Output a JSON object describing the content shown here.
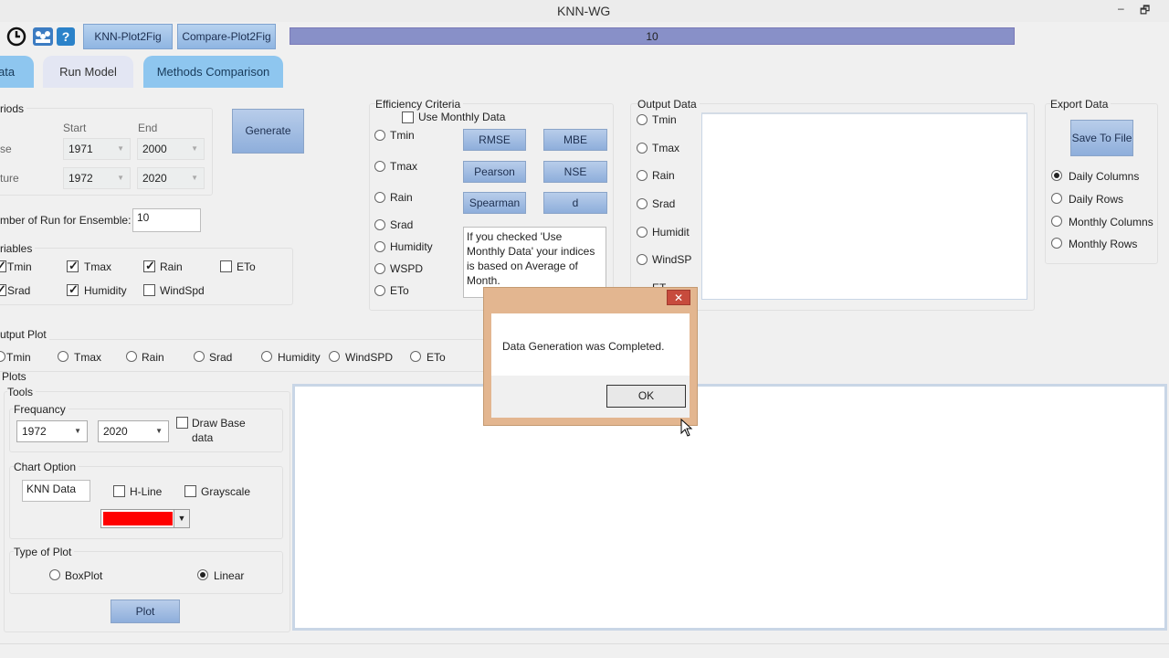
{
  "window": {
    "title": "KNN-WG"
  },
  "toolbar": {
    "icons": [
      "refresh-icon",
      "team-icon",
      "help-icon"
    ],
    "btn_plot2fig": "KNN-Plot2Fig",
    "btn_compare": "Compare-Plot2Fig",
    "progress_value": 10,
    "progress_fraction": 1.0
  },
  "tabs": {
    "data": "ata",
    "run": "Run Model",
    "methods": "Methods Comparison"
  },
  "periods": {
    "title": "riods",
    "start_label": "Start",
    "end_label": "End",
    "base_label": "se",
    "future_label": "ture",
    "base_start": "1971",
    "base_end": "2000",
    "future_start": "1972",
    "future_end": "2020"
  },
  "generate_label": "Generate",
  "ensemble": {
    "label": "mber of Run for Ensemble:",
    "value": "10"
  },
  "variables": {
    "title": "riables",
    "items": [
      {
        "label": "Tmin",
        "checked": true
      },
      {
        "label": "Tmax",
        "checked": true
      },
      {
        "label": "Rain",
        "checked": true
      },
      {
        "label": "ETo",
        "checked": false
      },
      {
        "label": "Srad",
        "checked": true
      },
      {
        "label": "Humidity",
        "checked": true
      },
      {
        "label": "WindSpd",
        "checked": false
      }
    ]
  },
  "efficiency": {
    "title": "Efficiency Criteria",
    "monthly_label": "Use Monthly Data",
    "radios": [
      "Tmin",
      "Tmax",
      "Rain",
      "Srad",
      "Humidity",
      "WSPD",
      "ETo"
    ],
    "buttons": {
      "rmse": "RMSE",
      "mbe": "MBE",
      "pearson": "Pearson",
      "nse": "NSE",
      "spearman": "Spearman",
      "d": "d"
    },
    "note": "If you checked 'Use Monthly Data' your indices is based on Average of Month."
  },
  "output_data": {
    "title": "Output Data",
    "radios": [
      "Tmin",
      "Tmax",
      "Rain",
      "Srad",
      "Humidit",
      "WindSPI",
      "ET"
    ]
  },
  "export": {
    "title": "Export  Data",
    "save_label": "Save To File",
    "options": [
      "Daily Columns",
      "Daily Rows",
      "Monthly Columns",
      "Monthly Rows"
    ],
    "selected": "Daily Columns"
  },
  "output_plot": {
    "title": "utput Plot",
    "options": [
      "Tmin",
      "Tmax",
      "Rain",
      "Srad",
      "Humidity",
      "WindSPD",
      "ETo"
    ]
  },
  "plots": {
    "title": "Plots",
    "tools_title": "Tools",
    "frequency_title": "Frequancy",
    "freq_from": "1972",
    "freq_to": "2020",
    "draw_base_label": "Draw Base data",
    "chart_option_title": "Chart Option",
    "chart_name": "KNN Data",
    "hline_label": "H-Line",
    "grayscale_label": "Grayscale",
    "line_color": "#ff0000",
    "type_title": "Type of Plot",
    "boxplot_label": "BoxPlot",
    "linear_label": "Linear",
    "plot_label": "Plot"
  },
  "dialog": {
    "message": "Data Generation was Completed.",
    "ok_label": "OK",
    "close_glyph": "✕"
  }
}
